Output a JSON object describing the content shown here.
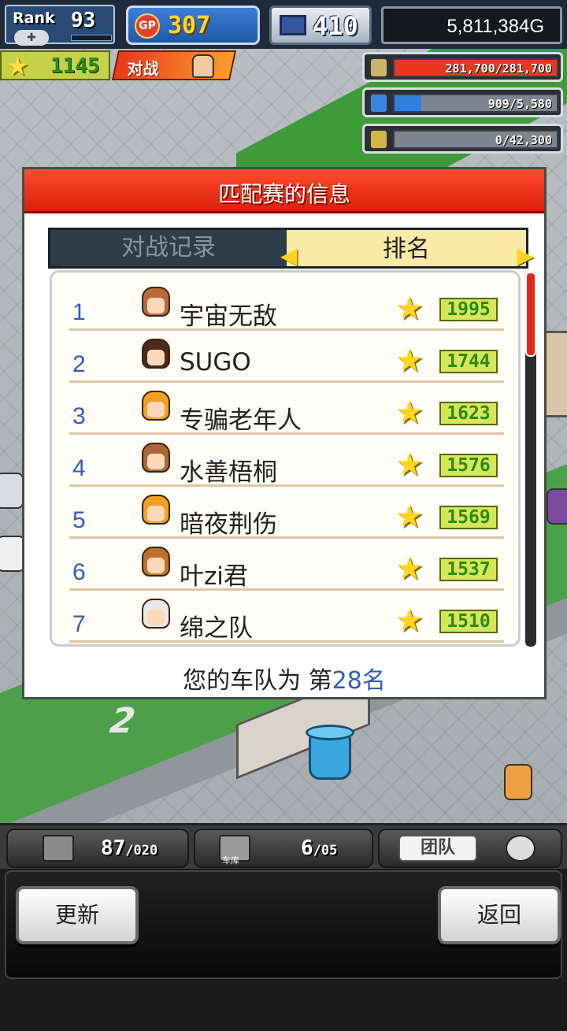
{
  "hud": {
    "rank_label": "Rank",
    "rank_value": "93",
    "gp_label": "GP",
    "gp_value": "307",
    "pc_value": "410",
    "money": "5,811,384G",
    "fame_value": "1145",
    "battle_label": "对战"
  },
  "resources": [
    {
      "icon": "money-stack-icon",
      "text": "281,700/281,700",
      "fill": 1.0,
      "color": "#e8391f"
    },
    {
      "icon": "fuel-can-icon",
      "text": "909/5,580",
      "fill": 0.163,
      "color": "#2f7fe0"
    },
    {
      "icon": "grain-icon",
      "text": "0/42,300",
      "fill": 0.0,
      "color": "#7bbf3a"
    }
  ],
  "dialog": {
    "title": "匹配赛的信息",
    "tab_history": "对战记录",
    "tab_ranking": "排名",
    "footer_prefix": "您的车队为 第",
    "footer_rank": "28",
    "footer_suffix": "名"
  },
  "rankings": [
    {
      "pos": "1",
      "name": "宇宙无敌",
      "points": "1995",
      "hair": "#b86a3a"
    },
    {
      "pos": "2",
      "name": "SUGO",
      "points": "1744",
      "hair": "#4a2a1a"
    },
    {
      "pos": "3",
      "name": "专骗老年人",
      "points": "1623",
      "hair": "#f0a022"
    },
    {
      "pos": "4",
      "name": "水善梧桐",
      "points": "1576",
      "hair": "#a8683a"
    },
    {
      "pos": "5",
      "name": "暗夜荆伤",
      "points": "1569",
      "hair": "#f0a022"
    },
    {
      "pos": "6",
      "name": "叶zi君",
      "points": "1537",
      "hair": "#c0702a"
    },
    {
      "pos": "7",
      "name": "绵之队",
      "points": "1510",
      "hair": "#e8e8e8"
    }
  ],
  "bottom_strip": {
    "box_value": "87",
    "box_max": "/020",
    "garage_value": "6",
    "garage_max": "/05",
    "garage_label": "车库",
    "team_label": "团队"
  },
  "buttons": {
    "update": "更新",
    "back": "返回"
  }
}
